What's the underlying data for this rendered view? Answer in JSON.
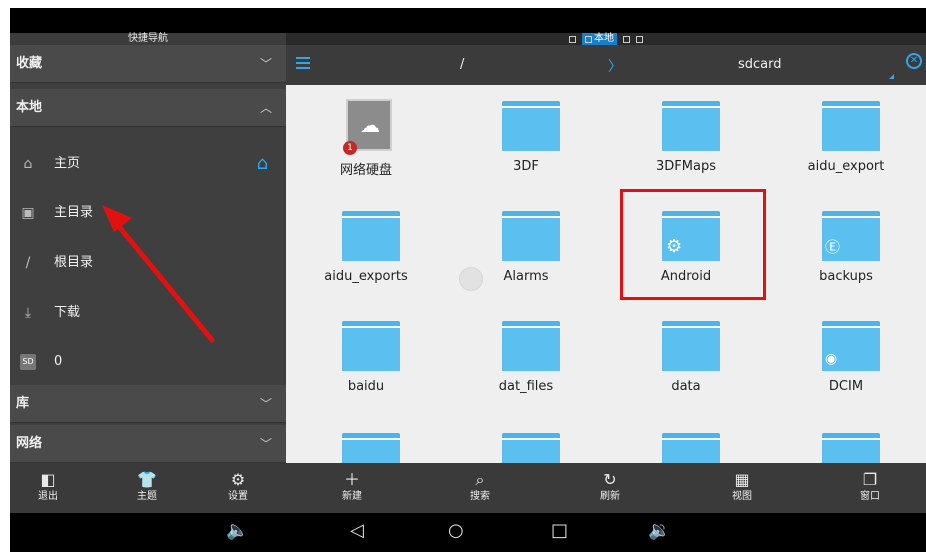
{
  "statusbar": {
    "sidebar_title": "快捷导航",
    "mode_active": "本地"
  },
  "sidebar": {
    "favorites": "收藏",
    "local": "本地",
    "items": [
      {
        "label": "主页",
        "icon": "home-icon"
      },
      {
        "label": "主目录",
        "icon": "folder-camera-icon"
      },
      {
        "label": "根目录",
        "icon": "slash-icon"
      },
      {
        "label": "下载",
        "icon": "download-icon"
      },
      {
        "label": "0",
        "icon": "sd-card-icon"
      }
    ],
    "library": "库",
    "network": "网络"
  },
  "pathbar": {
    "root": "/",
    "separator": "〉",
    "current": "sdcard"
  },
  "files": [
    {
      "name": "网络硬盘",
      "type": "cloud-drive"
    },
    {
      "name": "3DF",
      "type": "folder"
    },
    {
      "name": "3DFMaps",
      "type": "folder"
    },
    {
      "name": "aidu_export",
      "type": "folder"
    },
    {
      "name": "aidu_exports",
      "type": "folder"
    },
    {
      "name": "Alarms",
      "type": "folder"
    },
    {
      "name": "Android",
      "type": "folder",
      "overlay": "gear-icon"
    },
    {
      "name": "backups",
      "type": "folder",
      "overlay": "es-logo-icon"
    },
    {
      "name": "baidu",
      "type": "folder"
    },
    {
      "name": "dat_files",
      "type": "folder"
    },
    {
      "name": "data",
      "type": "folder"
    },
    {
      "name": "DCIM",
      "type": "folder",
      "overlay": "camera-icon"
    }
  ],
  "left_toolbar": [
    {
      "label": "退出",
      "icon": "exit-icon"
    },
    {
      "label": "主题",
      "icon": "shirt-icon"
    },
    {
      "label": "设置",
      "icon": "gear-icon"
    }
  ],
  "main_toolbar": [
    {
      "label": "新建",
      "icon": "plus-icon"
    },
    {
      "label": "搜索",
      "icon": "search-icon"
    },
    {
      "label": "刷新",
      "icon": "refresh-icon"
    },
    {
      "label": "视图",
      "icon": "grid-view-icon"
    },
    {
      "label": "窗口",
      "icon": "windows-icon"
    }
  ],
  "colors": {
    "accent": "#2fa6f0",
    "folder": "#5bc0f0",
    "highlight": "#e31010"
  }
}
